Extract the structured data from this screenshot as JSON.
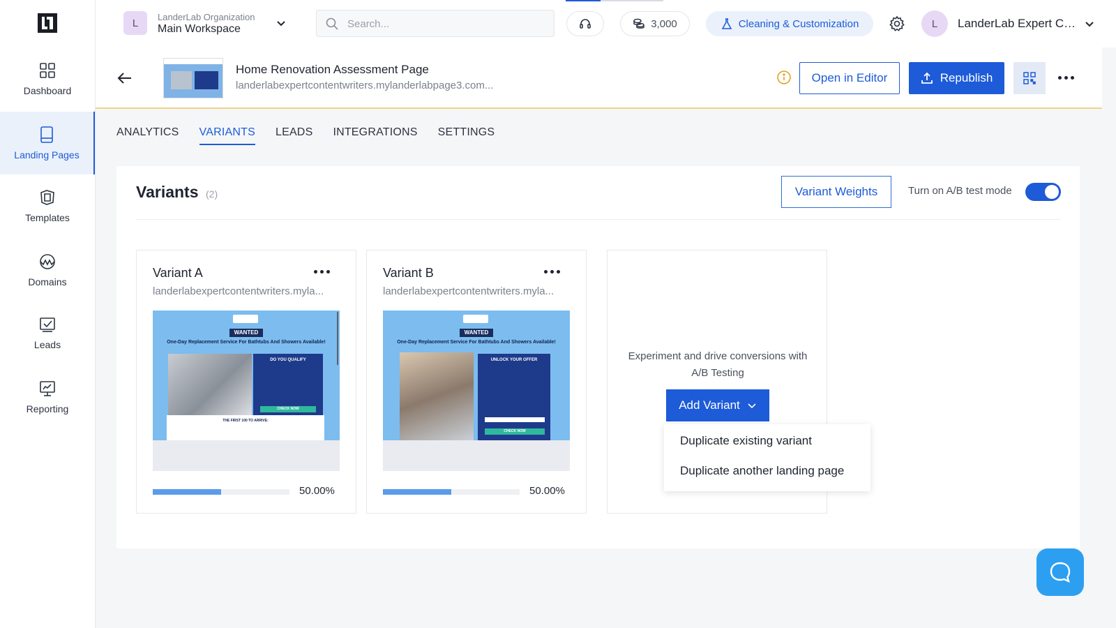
{
  "sidebar": {
    "items": [
      {
        "label": "Dashboard",
        "icon": "dashboard-icon"
      },
      {
        "label": "Landing Pages",
        "icon": "landing-pages-icon",
        "active": true
      },
      {
        "label": "Templates",
        "icon": "templates-icon"
      },
      {
        "label": "Domains",
        "icon": "domains-icon"
      },
      {
        "label": "Leads",
        "icon": "leads-icon"
      },
      {
        "label": "Reporting",
        "icon": "reporting-icon"
      }
    ]
  },
  "topbar": {
    "workspace_initial": "L",
    "org_name": "LanderLab Organization",
    "workspace_name": "Main Workspace",
    "search_placeholder": "Search...",
    "credits": "3,000",
    "cleaning_label": "Cleaning & Customization",
    "user_initial": "L",
    "user_name": "LanderLab Expert Co..."
  },
  "page": {
    "title": "Home Renovation Assessment Page",
    "url": "landerlabexpertcontentwriters.mylanderlabpage3.com...",
    "open_editor_label": "Open in Editor",
    "republish_label": "Republish"
  },
  "tabs": [
    {
      "label": "ANALYTICS"
    },
    {
      "label": "VARIANTS",
      "active": true
    },
    {
      "label": "LEADS"
    },
    {
      "label": "INTEGRATIONS"
    },
    {
      "label": "SETTINGS"
    }
  ],
  "variants_section": {
    "title": "Variants",
    "count": "(2)",
    "weights_label": "Variant Weights",
    "ab_label": "Turn on A/B test mode",
    "ab_enabled": true
  },
  "variants": [
    {
      "name": "Variant A",
      "url": "landerlabexpertcontentwriters.myla...",
      "weight_text": "50.00%",
      "weight": 0.5,
      "preview": {
        "tag": "WANTED",
        "headline": "One-Day Replacement Service For Bathtubs And Showers Available!",
        "box_title": "DO YOU QUALIFY",
        "cta": "CHECK NOW",
        "strip": "THE FIRST 100 TO ARRIVE:"
      }
    },
    {
      "name": "Variant B",
      "url": "landerlabexpertcontentwriters.myla...",
      "weight_text": "50.00%",
      "weight": 0.5,
      "preview": {
        "tag": "WANTED",
        "headline": "One-Day Replacement Service For Bathtubs And Showers Available!",
        "box_title": "UNLOCK YOUR OFFER",
        "cta": "CHECK NOW"
      }
    }
  ],
  "add_variant": {
    "text": "Experiment and drive conversions with A/B Testing",
    "button_label": "Add Variant",
    "menu": [
      {
        "label": "Duplicate existing variant"
      },
      {
        "label": "Duplicate another landing page"
      }
    ]
  },
  "colors": {
    "accent": "#1d5bd8",
    "progress": "#5b9bea",
    "chat": "#2d9ff0"
  }
}
